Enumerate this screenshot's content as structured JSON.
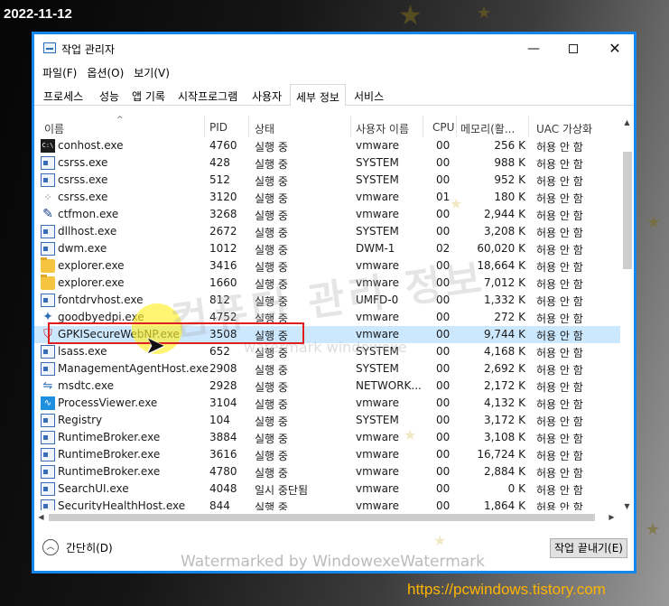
{
  "date_stamp": "2022-11-12",
  "site_url": "https://pcwindows.tistory.com",
  "window": {
    "title": "작업 관리자"
  },
  "menu": {
    "file": "파일(F)",
    "options": "옵션(O)",
    "view": "보기(V)"
  },
  "tabs": [
    "프로세스",
    "성능",
    "앱 기록",
    "시작프로그램",
    "사용자",
    "세부 정보",
    "서비스"
  ],
  "columns": {
    "name": "이름",
    "pid": "PID",
    "status": "상태",
    "user": "사용자 이름",
    "cpu": "CPU",
    "memory": "메모리(활...",
    "uac": "UAC 가상화"
  },
  "processes": [
    {
      "name": "conhost.exe",
      "pid": "4760",
      "status": "실행 중",
      "user": "vmware",
      "cpu": "00",
      "memory": "256 K",
      "uac": "허용 안 함",
      "icon": "console"
    },
    {
      "name": "csrss.exe",
      "pid": "428",
      "status": "실행 중",
      "user": "SYSTEM",
      "cpu": "00",
      "memory": "988 K",
      "uac": "허용 안 함",
      "icon": "app"
    },
    {
      "name": "csrss.exe",
      "pid": "512",
      "status": "실행 중",
      "user": "SYSTEM",
      "cpu": "00",
      "memory": "952 K",
      "uac": "허용 안 함",
      "icon": "app"
    },
    {
      "name": "csrss.exe",
      "pid": "3120",
      "status": "실행 중",
      "user": "vmware",
      "cpu": "01",
      "memory": "180 K",
      "uac": "허용 안 함",
      "icon": "cursor"
    },
    {
      "name": "ctfmon.exe",
      "pid": "3268",
      "status": "실행 중",
      "user": "vmware",
      "cpu": "00",
      "memory": "2,944 K",
      "uac": "허용 안 함",
      "icon": "pen"
    },
    {
      "name": "dllhost.exe",
      "pid": "2672",
      "status": "실행 중",
      "user": "SYSTEM",
      "cpu": "00",
      "memory": "3,208 K",
      "uac": "허용 안 함",
      "icon": "app"
    },
    {
      "name": "dwm.exe",
      "pid": "1012",
      "status": "실행 중",
      "user": "DWM-1",
      "cpu": "02",
      "memory": "60,020 K",
      "uac": "허용 안 함",
      "icon": "app"
    },
    {
      "name": "explorer.exe",
      "pid": "3416",
      "status": "실행 중",
      "user": "vmware",
      "cpu": "00",
      "memory": "18,664 K",
      "uac": "허용 안 함",
      "icon": "folder"
    },
    {
      "name": "explorer.exe",
      "pid": "1660",
      "status": "실행 중",
      "user": "vmware",
      "cpu": "00",
      "memory": "7,012 K",
      "uac": "허용 안 함",
      "icon": "folder"
    },
    {
      "name": "fontdrvhost.exe",
      "pid": "812",
      "status": "실행 중",
      "user": "UMFD-0",
      "cpu": "00",
      "memory": "1,332 K",
      "uac": "허용 안 함",
      "icon": "app"
    },
    {
      "name": "goodbyedpi.exe",
      "pid": "4752",
      "status": "실행 중",
      "user": "vmware",
      "cpu": "00",
      "memory": "272 K",
      "uac": "허용 안 함",
      "icon": "globe"
    },
    {
      "name": "GPKISecureWebNP.exe",
      "pid": "3508",
      "status": "실행 중",
      "user": "vmware",
      "cpu": "00",
      "memory": "9,744 K",
      "uac": "허용 안 함",
      "icon": "shield",
      "selected": true
    },
    {
      "name": "lsass.exe",
      "pid": "652",
      "status": "실행 중",
      "user": "SYSTEM",
      "cpu": "00",
      "memory": "4,168 K",
      "uac": "허용 안 함",
      "icon": "app"
    },
    {
      "name": "ManagementAgentHost.exe",
      "pid": "2908",
      "status": "실행 중",
      "user": "SYSTEM",
      "cpu": "00",
      "memory": "2,692 K",
      "uac": "허용 안 함",
      "icon": "app"
    },
    {
      "name": "msdtc.exe",
      "pid": "2928",
      "status": "실행 중",
      "user": "NETWORK...",
      "cpu": "00",
      "memory": "2,172 K",
      "uac": "허용 안 함",
      "icon": "net"
    },
    {
      "name": "ProcessViewer.exe",
      "pid": "3104",
      "status": "실행 중",
      "user": "vmware",
      "cpu": "00",
      "memory": "4,132 K",
      "uac": "허용 안 함",
      "icon": "pv"
    },
    {
      "name": "Registry",
      "pid": "104",
      "status": "실행 중",
      "user": "SYSTEM",
      "cpu": "00",
      "memory": "3,172 K",
      "uac": "허용 안 함",
      "icon": "app"
    },
    {
      "name": "RuntimeBroker.exe",
      "pid": "3884",
      "status": "실행 중",
      "user": "vmware",
      "cpu": "00",
      "memory": "3,108 K",
      "uac": "허용 안 함",
      "icon": "app"
    },
    {
      "name": "RuntimeBroker.exe",
      "pid": "3616",
      "status": "실행 중",
      "user": "vmware",
      "cpu": "00",
      "memory": "16,724 K",
      "uac": "허용 안 함",
      "icon": "app"
    },
    {
      "name": "RuntimeBroker.exe",
      "pid": "4780",
      "status": "실행 중",
      "user": "vmware",
      "cpu": "00",
      "memory": "2,884 K",
      "uac": "허용 안 함",
      "icon": "app"
    },
    {
      "name": "SearchUI.exe",
      "pid": "4048",
      "status": "일시 중단됨",
      "user": "vmware",
      "cpu": "00",
      "memory": "0 K",
      "uac": "허용 안 함",
      "icon": "app"
    },
    {
      "name": "SecurityHealthHost.exe",
      "pid": "844",
      "status": "실행 중",
      "user": "vmware",
      "cpu": "00",
      "memory": "1,864 K",
      "uac": "허용 안 함",
      "icon": "app"
    }
  ],
  "footer": {
    "fewer_details": "간단히(D)",
    "end_task": "작업 끝내기(E)"
  },
  "watermarks": {
    "center": "컴퓨터 관리 정보",
    "mid": "watermark windowexe",
    "bottom": "Watermarked by WindowexeWatermark"
  }
}
